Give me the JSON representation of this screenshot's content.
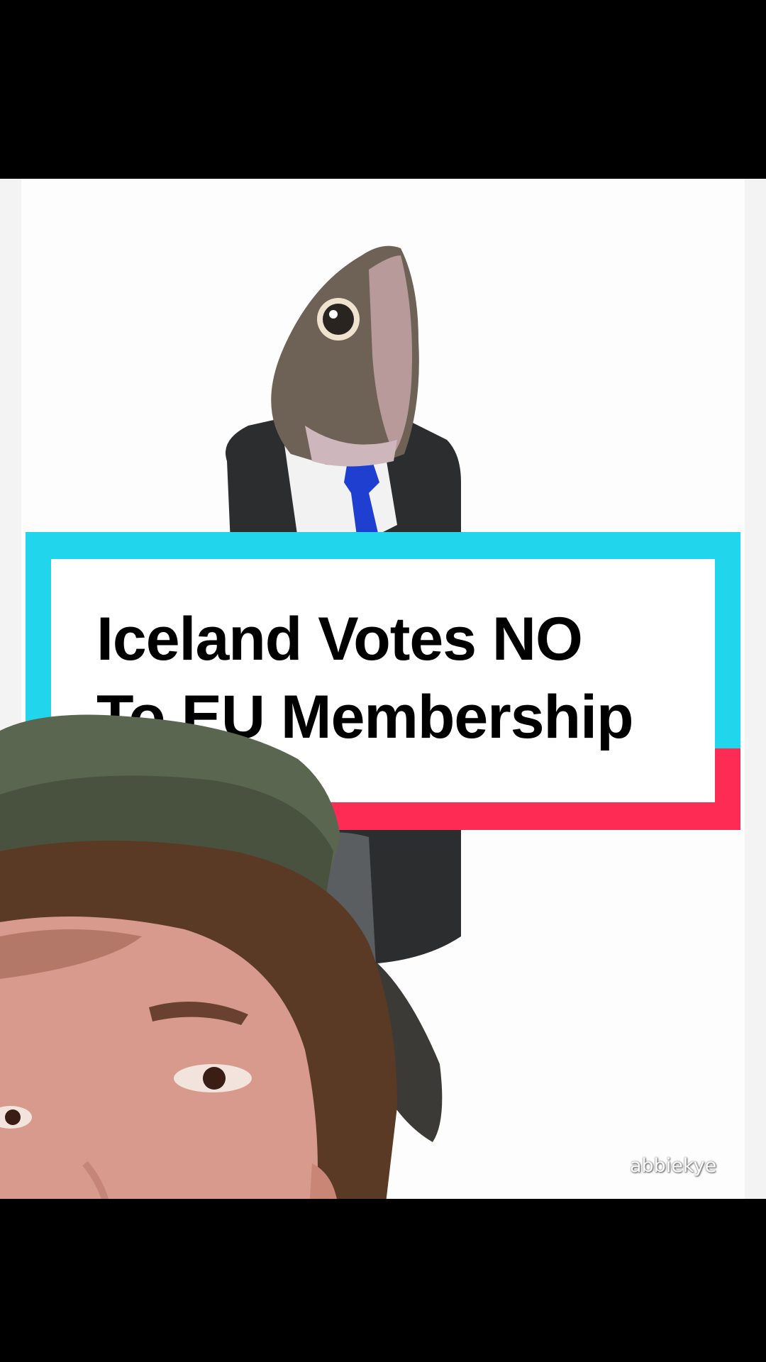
{
  "overlay": {
    "title_line1": "Iceland Votes NO",
    "title_line2": "To EU Membership"
  },
  "watermark": {
    "text": "abbiekye"
  },
  "colors": {
    "cyan": "#20d5ec",
    "pink": "#fe2c55",
    "dark": "#161823",
    "tie_blue": "#1f3fd0"
  }
}
